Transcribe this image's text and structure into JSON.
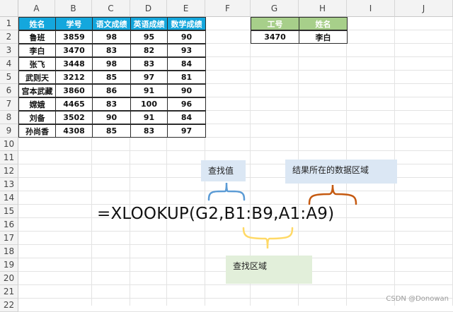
{
  "spreadsheet": {
    "columns": [
      "A",
      "B",
      "C",
      "D",
      "E",
      "F",
      "G",
      "H",
      "I",
      "J"
    ],
    "rows": [
      "1",
      "2",
      "3",
      "4",
      "5",
      "6",
      "7",
      "8",
      "9",
      "10",
      "11",
      "12",
      "13",
      "14",
      "15",
      "16",
      "17",
      "18",
      "19",
      "20",
      "21",
      "22"
    ]
  },
  "main_table": {
    "headers": [
      "姓名",
      "学号",
      "语文成绩",
      "英语成绩",
      "数学成绩"
    ],
    "rows": [
      [
        "鲁班",
        "3859",
        "98",
        "95",
        "90"
      ],
      [
        "李白",
        "3470",
        "83",
        "82",
        "93"
      ],
      [
        "张飞",
        "3448",
        "98",
        "83",
        "84"
      ],
      [
        "武则天",
        "3212",
        "85",
        "97",
        "81"
      ],
      [
        "宫本武藏",
        "3860",
        "86",
        "91",
        "90"
      ],
      [
        "嫦娥",
        "4465",
        "83",
        "100",
        "96"
      ],
      [
        "刘备",
        "3502",
        "90",
        "91",
        "84"
      ],
      [
        "孙尚香",
        "4308",
        "85",
        "83",
        "97"
      ]
    ]
  },
  "lookup_table": {
    "headers": [
      "工号",
      "姓名"
    ],
    "values": [
      "3470",
      "李白"
    ]
  },
  "formula": "=XLOOKUP(G2,B1:B9,A1:A9)",
  "annotations": {
    "lookup_value": "查找值",
    "result_range": "结果所在的数据区域",
    "lookup_range": "查找区域"
  },
  "watermark": "CSDN @Donowan",
  "colors": {
    "header_blue": "#14a7dd",
    "header_green": "#a7cf8a",
    "brace_blue": "#5b9bd5",
    "brace_orange": "#c55a11",
    "brace_yellow": "#ffd966",
    "note_blue": "#dbe7f4",
    "note_green": "#e2efda"
  }
}
